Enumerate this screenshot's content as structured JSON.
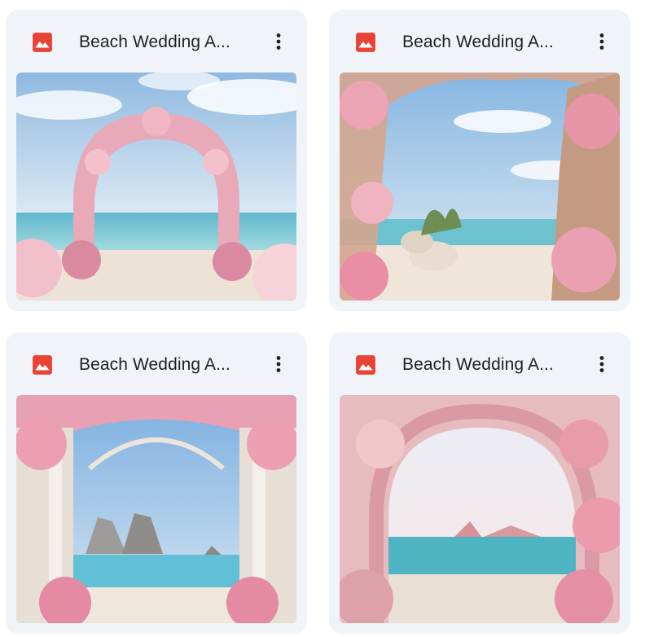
{
  "files": [
    {
      "name": "Beach Wedding A...",
      "icon": "image-file-icon",
      "menu_icon": "more-vert-icon"
    },
    {
      "name": "Beach Wedding A...",
      "icon": "image-file-icon",
      "menu_icon": "more-vert-icon"
    },
    {
      "name": "Beach Wedding A...",
      "icon": "image-file-icon",
      "menu_icon": "more-vert-icon"
    },
    {
      "name": "Beach Wedding A...",
      "icon": "image-file-icon",
      "menu_icon": "more-vert-icon"
    }
  ],
  "colors": {
    "card_background": "#f0f4f9",
    "image_icon_red": "#ea4335",
    "text": "#1f1f1f"
  }
}
